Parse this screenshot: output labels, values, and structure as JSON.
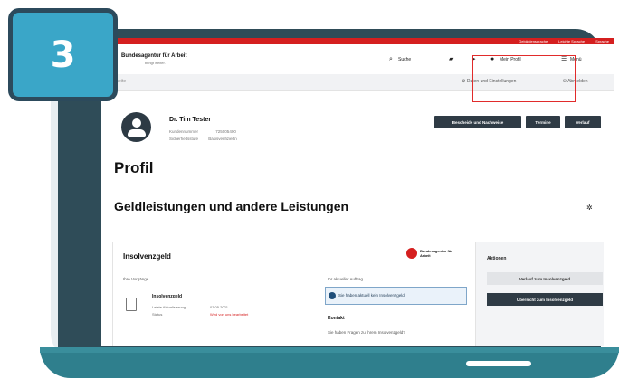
{
  "step": "3",
  "site": {
    "logo_text": "Bundesagentur für Arbeit",
    "logo_sub": "bringt weiter.",
    "top_links": [
      "Gebärdensprache",
      "Leichte Sprache",
      "Sprache"
    ]
  },
  "header": {
    "search_label": "Suche",
    "profile_label": "Mein Profil",
    "menu_label": "Menü"
  },
  "crumb": {
    "left": "Startseite",
    "settings_label": "Daten und Einstellungen",
    "logout_label": "Abmelden"
  },
  "profile": {
    "name": "Dr. Tim Tester",
    "number_label": "Kundennummer",
    "number_value": "725005400",
    "status_label": "Sicherheitsstufe",
    "status_value": "Basisverifiziertn",
    "buttons": [
      "Bescheide und Nachweise",
      "Termine",
      "Verlauf"
    ]
  },
  "page_title": "Profil",
  "section_title": "Geldleistungen und andere Leistungen",
  "card": {
    "title": "Insolvenzgeld",
    "logo_text": "Bundesagentur für Arbeit",
    "col_left": "Ihre Vorgänge",
    "col_right": "Ihr aktueller Auftrag",
    "doc_title": "Insolvenzgeld",
    "doc_meta1_label": "Letzte Aktualisierung",
    "doc_meta1_value": "07.05.2021",
    "doc_meta2_label": "Status",
    "doc_meta2_value": "Wird von uns bearbeitet",
    "info_text": "Sie haben aktuell kein Insolvenzgeld.",
    "sub_head": "Kontakt",
    "sub_text": "Sie haben Fragen zu Ihrem Insolvenzgeld?"
  },
  "side": {
    "title": "Aktionen",
    "btn_light": "Verlauf zum Insolvenzgeld",
    "btn_dark": "Übersicht zum Insolvenzgeld"
  }
}
